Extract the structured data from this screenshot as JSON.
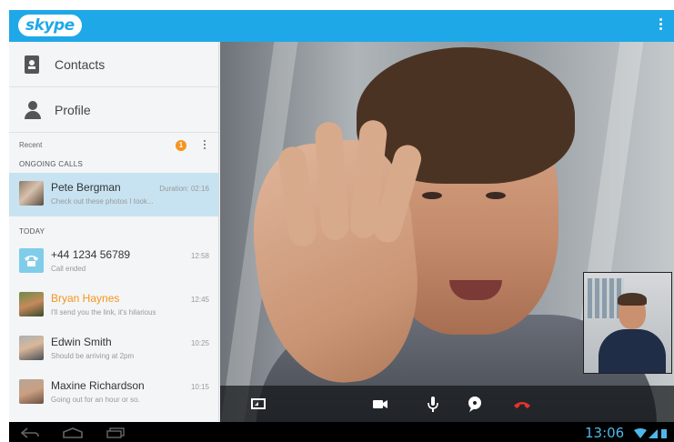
{
  "app": {
    "logo_text": "skype",
    "brand_color": "#1fa8e8",
    "accent_color": "#f7941d"
  },
  "nav": [
    {
      "label": "Contacts",
      "icon": "contacts-icon"
    },
    {
      "label": "Profile",
      "icon": "profile-icon"
    }
  ],
  "recent": {
    "label": "Recent",
    "badge": "1"
  },
  "sections": {
    "ongoing": "ONGOING CALLS",
    "today": "TODAY"
  },
  "ongoing_calls": [
    {
      "name": "Pete Bergman",
      "subtitle": "Check out these photos I took...",
      "duration_label": "Duration:",
      "duration": "02:16"
    }
  ],
  "today_calls": [
    {
      "name": "+44 1234 56789",
      "subtitle": "Call ended",
      "time": "12:58",
      "missed": false
    },
    {
      "name": "Bryan Haynes",
      "subtitle": "I'll send you the link, it's hilarious",
      "time": "12:45",
      "missed": true
    },
    {
      "name": "Edwin Smith",
      "subtitle": "Should be arriving at 2pm",
      "time": "10:25",
      "missed": false
    },
    {
      "name": "Maxine Richardson",
      "subtitle": "Going out for an hour or so.",
      "time": "10:15",
      "missed": false
    }
  ],
  "call_controls": [
    "expand-icon",
    "video-camera-icon",
    "microphone-icon",
    "chat-bubble-icon",
    "end-call-icon"
  ],
  "system_bar": {
    "clock": "13:06",
    "icons": [
      "back-icon",
      "home-icon",
      "recent-apps-icon",
      "wifi-icon",
      "signal-icon",
      "battery-icon"
    ]
  }
}
